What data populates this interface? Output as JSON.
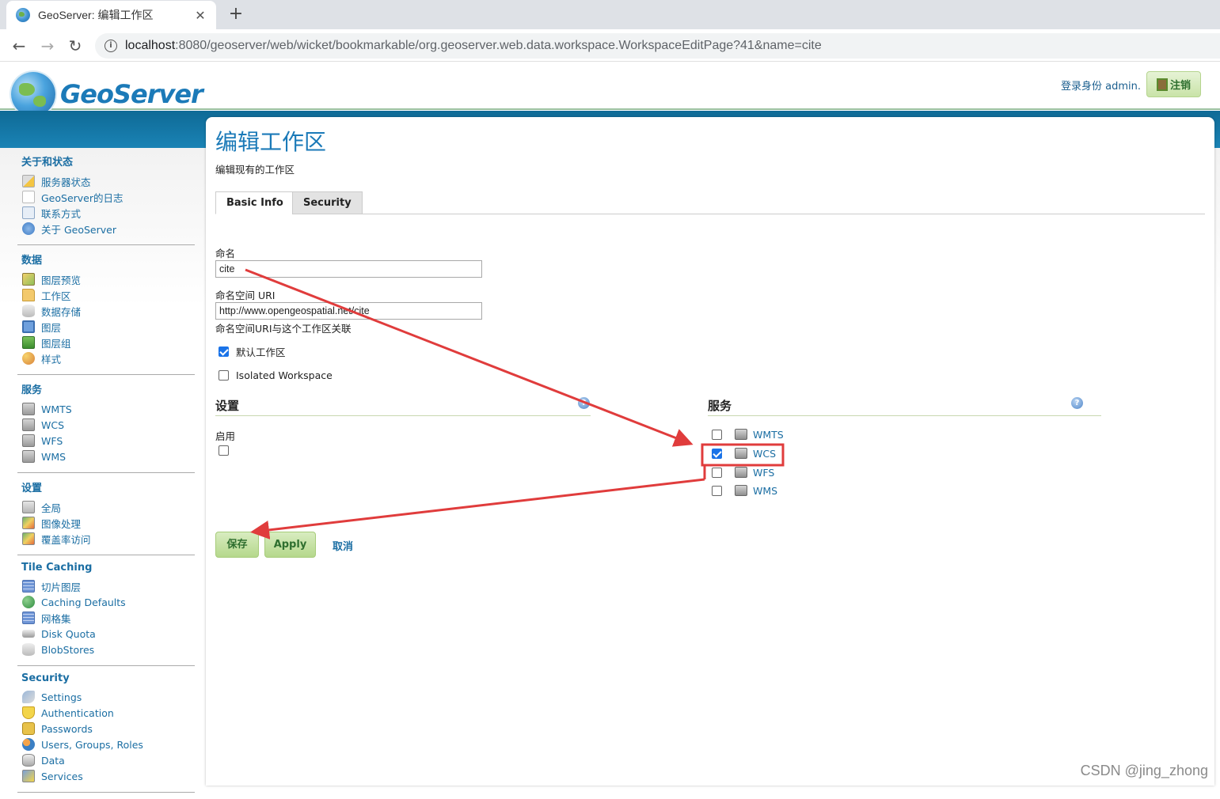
{
  "browser": {
    "tab_title": "GeoServer: 编辑工作区",
    "close_symbol": "✕",
    "new_tab_symbol": "+",
    "url_host": "localhost",
    "url_rest": ":8080/geoserver/web/wicket/bookmarkable/org.geoserver.web.data.workspace.WorkspaceEditPage?41&name=cite",
    "back_symbol": "←",
    "forward_symbol": "→",
    "reload_symbol": "↻",
    "info_symbol": "i"
  },
  "header": {
    "logo_text": "GeoServer",
    "login_info": "登录身份 admin.",
    "logout_label": "注销"
  },
  "sidebar": {
    "sections": [
      {
        "title": "关于和状态",
        "items": [
          {
            "label": "服务器状态",
            "icon": "server-status-icon"
          },
          {
            "label": "GeoServer的日志",
            "icon": "log-icon"
          },
          {
            "label": "联系方式",
            "icon": "contact-icon"
          },
          {
            "label": "关于 GeoServer",
            "icon": "help-icon"
          }
        ]
      },
      {
        "title": "数据",
        "items": [
          {
            "label": "图层预览",
            "icon": "map-icon"
          },
          {
            "label": "工作区",
            "icon": "folder-icon"
          },
          {
            "label": "数据存储",
            "icon": "database-icon"
          },
          {
            "label": "图层",
            "icon": "layer-icon"
          },
          {
            "label": "图层组",
            "icon": "layer-group-icon"
          },
          {
            "label": "样式",
            "icon": "palette-icon"
          }
        ]
      },
      {
        "title": "服务",
        "items": [
          {
            "label": "WMTS",
            "icon": "server-icon"
          },
          {
            "label": "WCS",
            "icon": "server-icon"
          },
          {
            "label": "WFS",
            "icon": "server-icon"
          },
          {
            "label": "WMS",
            "icon": "server-icon"
          }
        ]
      },
      {
        "title": "设置",
        "items": [
          {
            "label": "全局",
            "icon": "settings-icon"
          },
          {
            "label": "图像处理",
            "icon": "image-icon"
          },
          {
            "label": "覆盖率访问",
            "icon": "image-icon"
          }
        ]
      },
      {
        "title": "Tile Caching",
        "items": [
          {
            "label": "切片图层",
            "icon": "grid-icon"
          },
          {
            "label": "Caching Defaults",
            "icon": "globe-icon"
          },
          {
            "label": "网格集",
            "icon": "grid-icon"
          },
          {
            "label": "Disk Quota",
            "icon": "disk-icon"
          },
          {
            "label": "BlobStores",
            "icon": "database-icon"
          }
        ]
      },
      {
        "title": "Security",
        "items": [
          {
            "label": "Settings",
            "icon": "key-icon"
          },
          {
            "label": "Authentication",
            "icon": "shield-icon"
          },
          {
            "label": "Passwords",
            "icon": "lock-icon"
          },
          {
            "label": "Users, Groups, Roles",
            "icon": "users-icon"
          },
          {
            "label": "Data",
            "icon": "database-icon"
          },
          {
            "label": "Services",
            "icon": "services-icon"
          }
        ]
      }
    ]
  },
  "main": {
    "title": "编辑工作区",
    "description": "编辑现有的工作区",
    "tabs": [
      {
        "label": "Basic Info",
        "active": true
      },
      {
        "label": "Security",
        "active": false
      }
    ],
    "name_label": "命名",
    "name_value": "cite",
    "uri_label": "命名空间 URI",
    "uri_value": "http://www.opengeospatial.net/cite",
    "uri_help": "命名空间URI与这个工作区关联",
    "default_ws_label": "默认工作区",
    "default_ws_checked": true,
    "isolated_label": "Isolated Workspace",
    "isolated_checked": false,
    "settings_heading": "设置",
    "enable_label": "启用",
    "enable_checked": false,
    "services_heading": "服务",
    "help_symbol": "?",
    "services": [
      {
        "label": "WMTS",
        "checked": false
      },
      {
        "label": "WCS",
        "checked": true
      },
      {
        "label": "WFS",
        "checked": false
      },
      {
        "label": "WMS",
        "checked": false
      }
    ],
    "save_label": "保存",
    "apply_label": "Apply",
    "cancel_label": "取消"
  },
  "annotation_color": "#e03c3c",
  "watermark": "CSDN @jing_zhong"
}
